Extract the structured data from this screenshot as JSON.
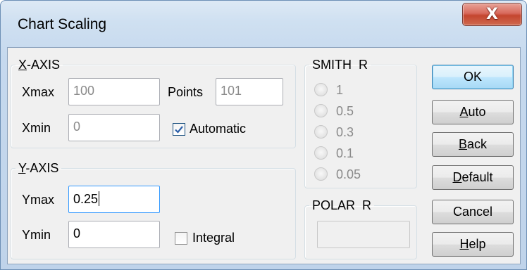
{
  "window": {
    "title": "Chart Scaling",
    "close_glyph": "X"
  },
  "x_axis": {
    "legend_prefix": "X",
    "legend_rest": "-AXIS",
    "xmax_label": "Xmax",
    "xmax_value": "100",
    "xmin_label": "Xmin",
    "xmin_value": "0",
    "points_label": "Points",
    "points_value": "101",
    "automatic_label": "Automatic",
    "automatic_checked": true
  },
  "y_axis": {
    "legend_prefix": "Y",
    "legend_rest": "-AXIS",
    "ymax_label": "Ymax",
    "ymax_value": "0.25",
    "ymin_label": "Ymin",
    "ymin_value": "0",
    "integral_label": "Integral",
    "integral_checked": false
  },
  "smith": {
    "legend": "SMITH  R",
    "options": [
      "1",
      "0.5",
      "0.3",
      "0.1",
      "0.05"
    ]
  },
  "polar": {
    "legend": "POLAR  R",
    "value": ""
  },
  "buttons": {
    "ok": "OK",
    "auto_u": "A",
    "auto_rest": "uto",
    "back_u": "B",
    "back_rest": "ack",
    "default_u": "D",
    "default_rest": "efault",
    "cancel": "Cancel",
    "help_u": "H",
    "help_rest": "elp"
  },
  "colors": {
    "accent": "#3399ff",
    "close_red": "#c4452f",
    "disabled_text": "#8a8a8a"
  }
}
